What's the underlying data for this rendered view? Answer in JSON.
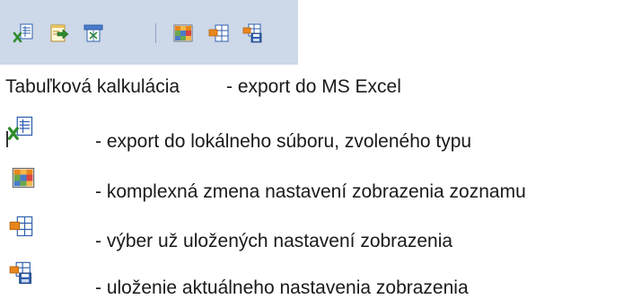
{
  "toolbar": {
    "icons": [
      "export-file-icon",
      "export-excel-icon",
      "print-report-icon",
      "grid-view-settings-icon",
      "select-saved-view-icon",
      "save-view-icon"
    ]
  },
  "intro": {
    "title": "Tabuľková kalkulácia",
    "description": "- export do MS Excel"
  },
  "rows": [
    {
      "icon": "export-file-icon",
      "text": "- export do lokálneho súboru, zvoleného typu"
    },
    {
      "icon": "grid-view-settings-icon",
      "text": "- komplexná zmena nastavení zobrazenia zoznamu"
    },
    {
      "icon": "select-saved-view-icon",
      "text": "- výber už uložených nastavení zobrazenia"
    },
    {
      "icon": "save-view-icon",
      "text": "- uloženie aktuálneho nastavenia zobrazenia"
    }
  ],
  "colors": {
    "toolbar_bg": "#cdd8e8",
    "icon_green": "#2e8b2e",
    "icon_blue": "#2f5fae",
    "icon_orange": "#e8861c"
  }
}
